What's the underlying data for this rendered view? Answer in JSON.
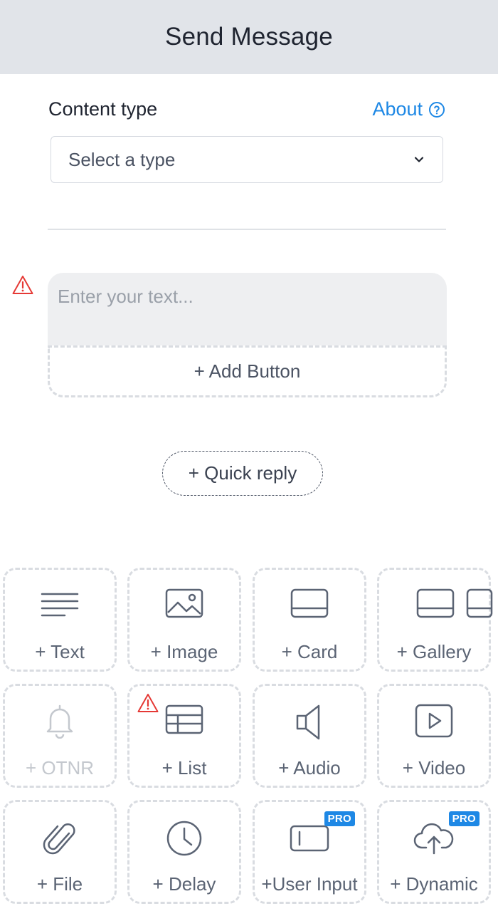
{
  "header": {
    "title": "Send Message"
  },
  "content_type": {
    "label": "Content type",
    "about_label": "About",
    "select_value": "Select a type"
  },
  "message": {
    "placeholder": "Enter your text...",
    "add_button_label": "+ Add Button"
  },
  "quick_reply_label": "+ Quick reply",
  "tiles": [
    {
      "label": "+ Text",
      "icon": "text-lines-icon",
      "disabled": false
    },
    {
      "label": "+ Image",
      "icon": "image-icon",
      "disabled": false
    },
    {
      "label": "+ Card",
      "icon": "card-icon",
      "disabled": false
    },
    {
      "label": "+ Gallery",
      "icon": "gallery-icon",
      "disabled": false
    },
    {
      "label": "+ OTNR",
      "icon": "bell-icon",
      "disabled": true
    },
    {
      "label": "+ List",
      "icon": "list-table-icon",
      "disabled": false,
      "warning": true
    },
    {
      "label": "+ Audio",
      "icon": "speaker-icon",
      "disabled": false
    },
    {
      "label": "+ Video",
      "icon": "play-icon",
      "disabled": false
    },
    {
      "label": "+ File",
      "icon": "paperclip-icon",
      "disabled": false
    },
    {
      "label": "+ Delay",
      "icon": "clock-icon",
      "disabled": false
    },
    {
      "label": "+User Input",
      "icon": "input-field-icon",
      "disabled": false,
      "badge": "PRO"
    },
    {
      "label": "+ Dynamic",
      "icon": "cloud-upload-icon",
      "disabled": false,
      "badge": "PRO"
    }
  ],
  "colors": {
    "accent": "#1e88e5",
    "warning": "#e53935",
    "header_bg": "#e1e4e9",
    "icon": "#5b6474",
    "disabled": "#c4c8ce"
  }
}
